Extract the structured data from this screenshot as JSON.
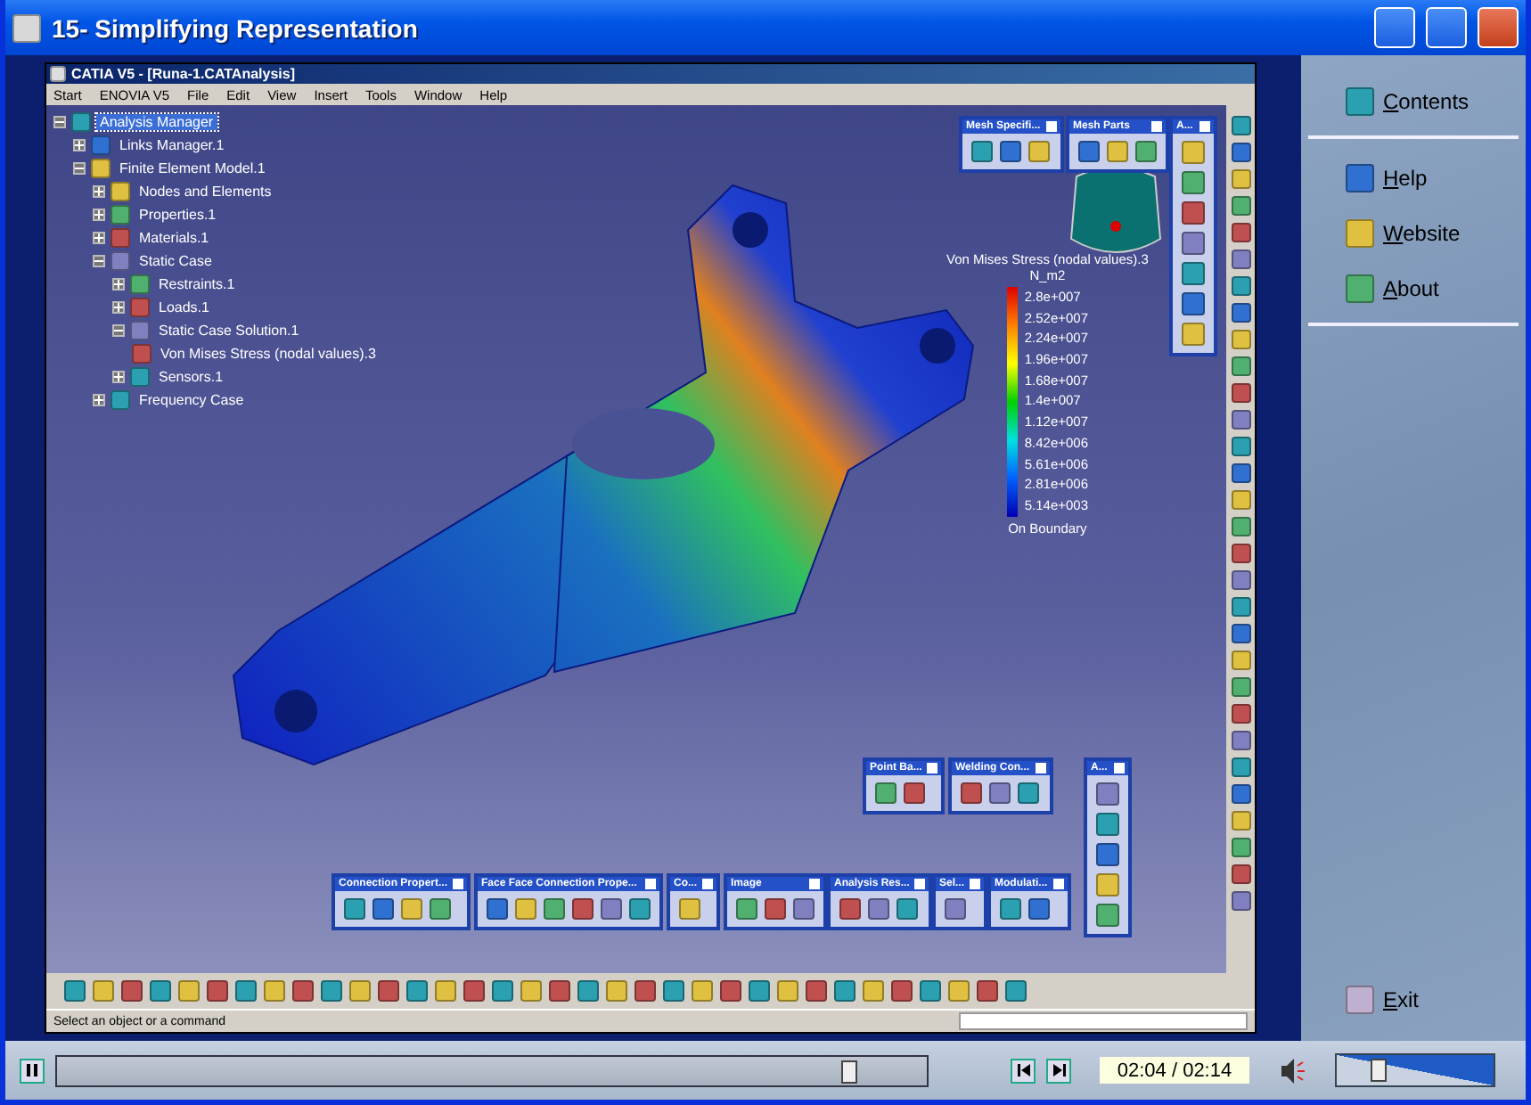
{
  "window": {
    "title": "15- Simplifying Representation"
  },
  "catia": {
    "title": "CATIA V5 - [Runa-1.CATAnalysis]",
    "menu": [
      "Start",
      "ENOVIA V5",
      "File",
      "Edit",
      "View",
      "Insert",
      "Tools",
      "Window",
      "Help"
    ],
    "tree": [
      {
        "label": "Analysis Manager",
        "selected": true,
        "expanded": true,
        "children": [
          {
            "label": "Links Manager.1",
            "selected": false,
            "expanded": false
          },
          {
            "label": "Finite Element Model.1",
            "selected": false,
            "expanded": true,
            "children": [
              {
                "label": "Nodes and Elements",
                "selected": false,
                "expanded": false
              },
              {
                "label": "Properties.1",
                "selected": false,
                "expanded": false
              },
              {
                "label": "Materials.1",
                "selected": false,
                "expanded": false
              },
              {
                "label": "Static Case",
                "selected": false,
                "expanded": true,
                "children": [
                  {
                    "label": "Restraints.1",
                    "selected": false,
                    "expanded": false
                  },
                  {
                    "label": "Loads.1",
                    "selected": false,
                    "expanded": false
                  },
                  {
                    "label": "Static Case Solution.1",
                    "selected": false,
                    "expanded": true,
                    "children": [
                      {
                        "label": "Von Mises Stress (nodal values).3",
                        "selected": false
                      }
                    ]
                  },
                  {
                    "label": "Sensors.1",
                    "selected": false,
                    "expanded": false
                  }
                ]
              },
              {
                "label": "Frequency Case",
                "selected": false,
                "expanded": false
              }
            ]
          }
        ]
      }
    ],
    "legend": {
      "title": "Von Mises Stress (nodal values).3",
      "unit": "N_m2",
      "values": [
        "2.8e+007",
        "2.52e+007",
        "2.24e+007",
        "1.96e+007",
        "1.68e+007",
        "1.4e+007",
        "1.12e+007",
        "8.42e+006",
        "5.61e+006",
        "2.81e+006",
        "5.14e+003"
      ],
      "footer": "On Boundary"
    },
    "toolbars": [
      {
        "title": "Mesh Specifi...",
        "kind": "horizontal"
      },
      {
        "title": "Mesh Parts",
        "kind": "horizontal"
      },
      {
        "title": "A...",
        "kind": "vertical"
      },
      {
        "title": "Point Ba...",
        "kind": "horizontal"
      },
      {
        "title": "Welding Con...",
        "kind": "horizontal"
      },
      {
        "title": "A...",
        "kind": "vertical"
      },
      {
        "title": "Connection Propert...",
        "kind": "horizontal"
      },
      {
        "title": "Face Face Connection Prope...",
        "kind": "horizontal"
      },
      {
        "title": "Co...",
        "kind": "horizontal"
      },
      {
        "title": "Image",
        "kind": "horizontal"
      },
      {
        "title": "Analysis Res...",
        "kind": "horizontal"
      },
      {
        "title": "Sel...",
        "kind": "horizontal"
      },
      {
        "title": "Modulati...",
        "kind": "horizontal"
      }
    ],
    "status": "Select an object or a command"
  },
  "sidebar": {
    "items": [
      "Contents",
      "Help",
      "Website",
      "About"
    ],
    "exit": "Exit"
  },
  "player": {
    "progress": {
      "level": 0.91
    },
    "time": "02:04 / 02:14",
    "volume": {
      "level": 0.26
    }
  }
}
